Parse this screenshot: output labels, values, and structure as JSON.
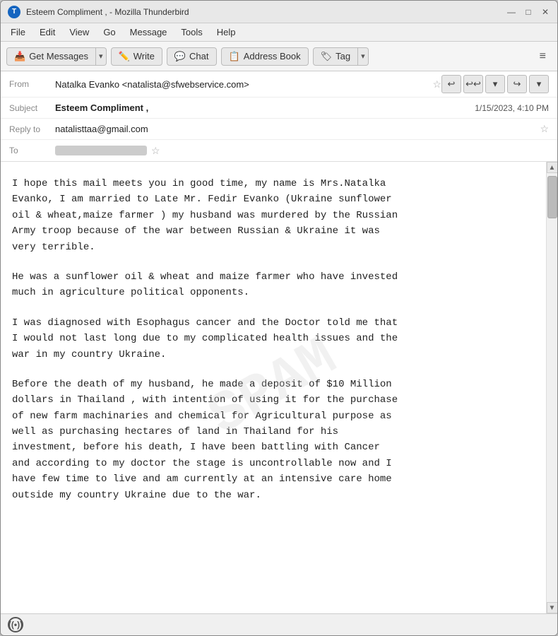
{
  "window": {
    "title": "Esteem Compliment , - Mozilla Thunderbird",
    "icon": "T"
  },
  "titlebar": {
    "controls": {
      "minimize": "—",
      "maximize": "□",
      "close": "✕"
    }
  },
  "menubar": {
    "items": [
      "File",
      "Edit",
      "View",
      "Go",
      "Message",
      "Tools",
      "Help"
    ]
  },
  "toolbar": {
    "get_messages": "Get Messages",
    "write": "Write",
    "chat": "Chat",
    "address_book": "Address Book",
    "tag": "Tag",
    "hamburger": "≡"
  },
  "email": {
    "from_label": "From",
    "from_value": "Natalka Evanko <natalista@sfwebservice.com>",
    "subject_label": "Subject",
    "subject_value": "Esteem Compliment ,",
    "date": "1/15/2023, 4:10 PM",
    "reply_to_label": "Reply to",
    "reply_to_value": "natalisttaa@gmail.com",
    "to_label": "To",
    "body": [
      "I hope this mail meets you in good time, my name is Mrs.Natalka\nEvanko, I am married to Late Mr. Fedir Evanko (Ukraine sunflower\noil & wheat,maize farmer ) my husband was murdered by the Russian\nArmy troop because of the war between Russian & Ukraine it was\nvery terrible.",
      "He was a sunflower oil & wheat and maize farmer who have invested\nmuch in agriculture political opponents.",
      "I was diagnosed with Esophagus cancer and the Doctor told me that\nI would not last long due to my complicated health issues and the\nwar in my country Ukraine.",
      "Before the death of my husband, he made a deposit of $10 Million\ndollars in Thailand , with intention of using it for the purchase\nof new farm machinaries and chemical for Agricultural purpose as\nwell as purchasing hectares of land in Thailand for his\ninvestment, before his death, I have been battling with Cancer\nand according to my doctor the stage is uncontrollable now and I\nhave few time to live and am currently at an intensive care home\noutside my country Ukraine due to the war."
    ]
  },
  "statusbar": {
    "icon": "((•))"
  }
}
